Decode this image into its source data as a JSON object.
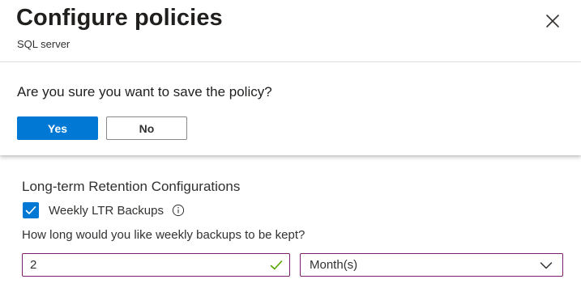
{
  "header": {
    "title": "Configure policies",
    "subtitle": "SQL server",
    "close_icon": "close-icon"
  },
  "confirm_dialog": {
    "message": "Are you sure you want to save the policy?",
    "yes_label": "Yes",
    "no_label": "No"
  },
  "ltr": {
    "section_title": "Long-term Retention Configurations",
    "weekly": {
      "checked": true,
      "label": "Weekly LTR Backups",
      "info_icon": "info-icon"
    },
    "question": "How long would you like weekly backups to be kept?",
    "duration_value": "2",
    "duration_valid_icon": "checkmark-icon",
    "unit_selected": "Month(s)",
    "unit_chevron_icon": "chevron-down-icon"
  },
  "colors": {
    "accent": "#0078d4",
    "field_border": "#7a1f6e",
    "valid_check": "#57a300"
  }
}
